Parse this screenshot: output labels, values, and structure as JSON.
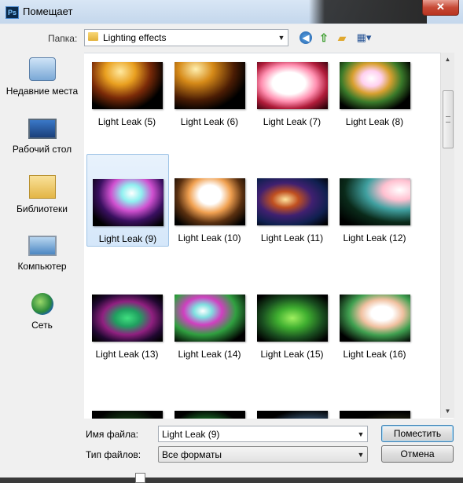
{
  "window": {
    "app_icon": "Ps",
    "title": "Помещает",
    "close_glyph": "✕"
  },
  "toolbar": {
    "folder_label": "Папка:",
    "folder_value": "Lighting effects",
    "icons": [
      "back-icon",
      "up-folder-icon",
      "new-folder-icon",
      "view-menu-icon"
    ]
  },
  "nav": {
    "items": [
      {
        "label": "Недавние места",
        "icon": "recent-places-icon"
      },
      {
        "label": "Рабочий стол",
        "icon": "desktop-icon"
      },
      {
        "label": "Библиотеки",
        "icon": "libraries-icon"
      },
      {
        "label": "Компьютер",
        "icon": "computer-icon"
      },
      {
        "label": "Сеть",
        "icon": "network-icon"
      }
    ]
  },
  "files": [
    {
      "label": "Light Leak (5)",
      "grad": "radial-gradient(ellipse at 40% 20%, #ffe9a0 0%, #e9a020 25%, #7a2a08 50%, #000 75%)"
    },
    {
      "label": "Light Leak (6)",
      "grad": "radial-gradient(ellipse at 30% 15%, #fff0b0 0%, #d68a18 25%, #4a1c04 55%, #000 75%)"
    },
    {
      "label": "Light Leak (7)",
      "grad": "radial-gradient(ellipse at 45% 45%, #ffffff 0%, #ffffff 30%, #ff8fb0 50%, #b01c3a 70%, #2a0008 95%)"
    },
    {
      "label": "Light Leak (8)",
      "grad": "radial-gradient(ellipse at 45% 35%, #ffffff 0%, #ffd0f0 18%, #d8a030 35%, #3a7a2a 55%, #000 80%)"
    },
    {
      "label": "Light Leak (9)",
      "grad": "radial-gradient(ellipse at 55% 30%, #ffffff 0%, #90f0f0 18%, #d050d0 38%, #3a1060 60%, #000 85%)",
      "selected": true
    },
    {
      "label": "Light Leak (10)",
      "grad": "radial-gradient(ellipse at 50% 35%, #ffffff 0%, #ffffff 22%, #f0a050 42%, #5a3010 65%, #000 90%)"
    },
    {
      "label": "Light Leak (11)",
      "grad": "radial-gradient(ellipse at 40% 45%, #ffe6a0 0%, #c05020 22%, #402070 45%, #102050 70%, #000 95%)"
    },
    {
      "label": "Light Leak (12)",
      "grad": "radial-gradient(ellipse at 85% 25%, #ffffff 0%, #ffc0d0 20%, #40a0a0 40%, #0a2a1a 65%, #000 90%)"
    },
    {
      "label": "Light Leak (13)",
      "grad": "radial-gradient(ellipse at 50% 50%, #40e080 0%, #20a060 25%, #902080 50%, #200830 75%, #000 95%)"
    },
    {
      "label": "Light Leak (14)",
      "grad": "radial-gradient(ellipse at 40% 35%, #ffffff 0%, #80e0e0 15%, #d040c0 32%, #30a040 55%, #000 85%)"
    },
    {
      "label": "Light Leak (15)",
      "grad": "radial-gradient(ellipse at 50% 50%, #a0f060 0%, #40b030 30%, #1a5020 60%, #000 90%)"
    },
    {
      "label": "Light Leak (16)",
      "grad": "radial-gradient(ellipse at 60% 40%, #ffffff 0%, #ffffff 18%, #f0c0a0 35%, #40a050 55%, #000 85%)"
    },
    {
      "label": "",
      "grad": "radial-gradient(ellipse at 50% 80%, #e0ffe0 0%, #40c040 25%, #103010 55%, #000 80%)"
    },
    {
      "label": "",
      "grad": "radial-gradient(ellipse at 45% 75%, #ffd0ff 0%, #40c0f0 22%, #208030 45%, #000 75%)"
    },
    {
      "label": "",
      "grad": "radial-gradient(ellipse at 75% 70%, #ffffff 0%, #80e0ff 20%, #406080 45%, #000 75%)"
    },
    {
      "label": "",
      "grad": "radial-gradient(ellipse at 80% 80%, #a0c080 0%, #404020 35%, #000 70%)"
    }
  ],
  "filename": {
    "label": "Имя файла:",
    "value": "Light Leak (9)"
  },
  "filetype": {
    "label": "Тип файлов:",
    "value": "Все форматы"
  },
  "buttons": {
    "place": "Поместить",
    "cancel": "Отмена"
  }
}
